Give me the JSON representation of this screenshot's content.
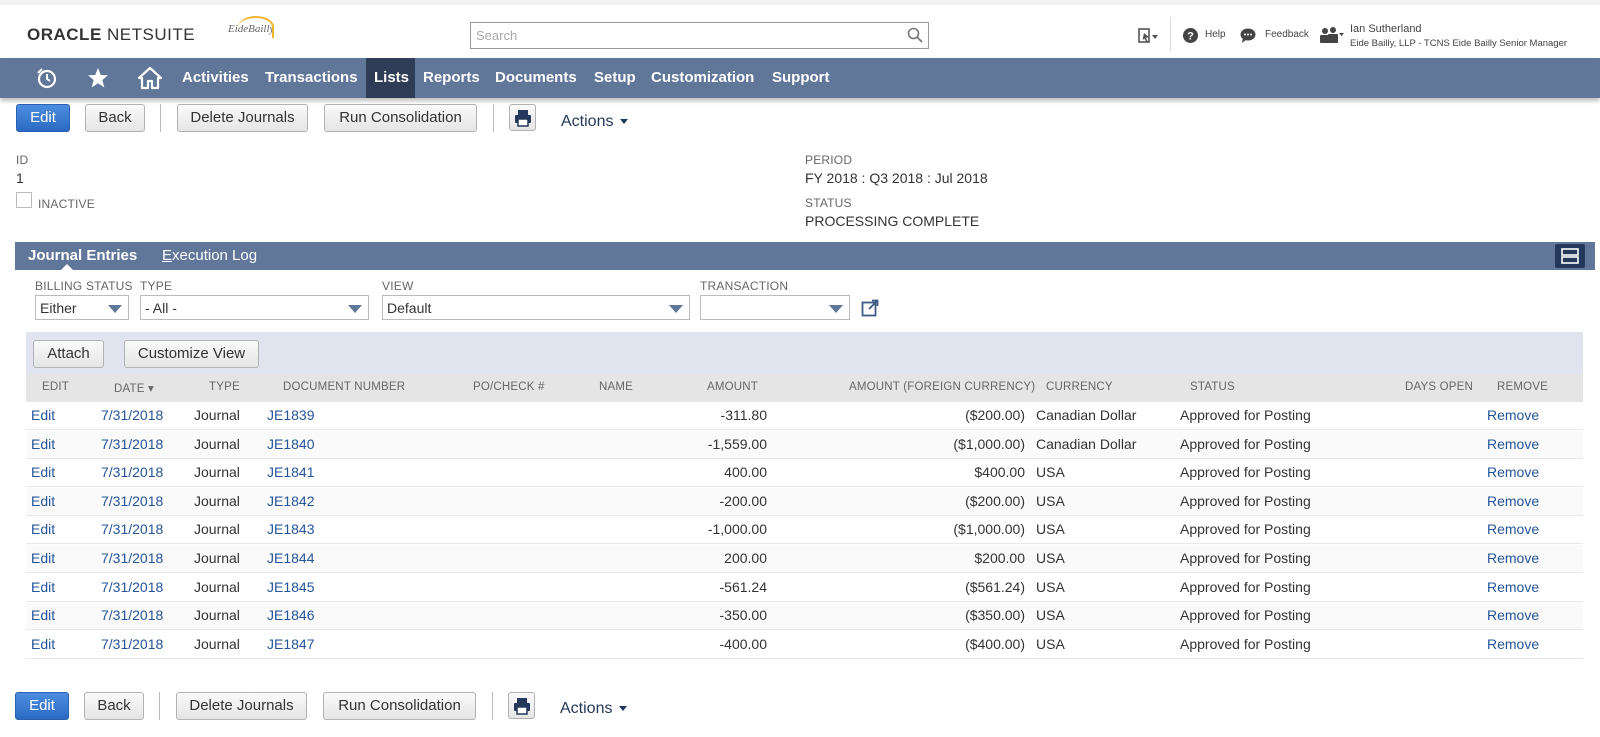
{
  "header": {
    "logo_oracle": "ORACLE",
    "logo_netsuite": "NETSUITE",
    "brand": "EideBailly",
    "search_placeholder": "Search",
    "help": "Help",
    "feedback": "Feedback",
    "user_name": "Ian Sutherland",
    "user_role": "Eide Bailly, LLP - TCNS Eide Bailly Senior Manager"
  },
  "nav": {
    "items": [
      "Activities",
      "Transactions",
      "Lists",
      "Reports",
      "Documents",
      "Setup",
      "Customization",
      "Support"
    ],
    "active": "Lists"
  },
  "toolbar": {
    "edit": "Edit",
    "back": "Back",
    "delete_journals": "Delete Journals",
    "run_consolidation": "Run Consolidation",
    "actions": "Actions"
  },
  "record": {
    "id_label": "ID",
    "id_value": "1",
    "inactive_label": "INACTIVE",
    "period_label": "PERIOD",
    "period_value": "FY 2018 : Q3 2018 : Jul 2018",
    "status_label": "STATUS",
    "status_value": "PROCESSING COMPLETE"
  },
  "subtabs": {
    "journal_entries": "Journal Entries",
    "execution_log_first": "E",
    "execution_log_rest": "xecution Log"
  },
  "filters": {
    "billing_status_label": "BILLING STATUS",
    "billing_status_value": "Either",
    "type_label": "TYPE",
    "type_value": "- All -",
    "view_label": "VIEW",
    "view_value": "Default",
    "transaction_label": "TRANSACTION",
    "transaction_value": ""
  },
  "list_buttons": {
    "attach": "Attach",
    "customize_view": "Customize View"
  },
  "table": {
    "columns": [
      "EDIT",
      "DATE ▾",
      "TYPE",
      "DOCUMENT NUMBER",
      "PO/CHECK #",
      "NAME",
      "AMOUNT",
      "AMOUNT (FOREIGN CURRENCY)",
      "CURRENCY",
      "STATUS",
      "DAYS OPEN",
      "REMOVE"
    ],
    "rows": [
      {
        "edit": "Edit",
        "date": "7/31/2018",
        "type": "Journal",
        "doc": "JE1839",
        "amount": "-311.80",
        "foreign": "($200.00)",
        "currency": "Canadian Dollar",
        "status": "Approved for Posting",
        "remove": "Remove"
      },
      {
        "edit": "Edit",
        "date": "7/31/2018",
        "type": "Journal",
        "doc": "JE1840",
        "amount": "-1,559.00",
        "foreign": "($1,000.00)",
        "currency": "Canadian Dollar",
        "status": "Approved for Posting",
        "remove": "Remove"
      },
      {
        "edit": "Edit",
        "date": "7/31/2018",
        "type": "Journal",
        "doc": "JE1841",
        "amount": "400.00",
        "foreign": "$400.00",
        "currency": "USA",
        "status": "Approved for Posting",
        "remove": "Remove"
      },
      {
        "edit": "Edit",
        "date": "7/31/2018",
        "type": "Journal",
        "doc": "JE1842",
        "amount": "-200.00",
        "foreign": "($200.00)",
        "currency": "USA",
        "status": "Approved for Posting",
        "remove": "Remove"
      },
      {
        "edit": "Edit",
        "date": "7/31/2018",
        "type": "Journal",
        "doc": "JE1843",
        "amount": "-1,000.00",
        "foreign": "($1,000.00)",
        "currency": "USA",
        "status": "Approved for Posting",
        "remove": "Remove"
      },
      {
        "edit": "Edit",
        "date": "7/31/2018",
        "type": "Journal",
        "doc": "JE1844",
        "amount": "200.00",
        "foreign": "$200.00",
        "currency": "USA",
        "status": "Approved for Posting",
        "remove": "Remove"
      },
      {
        "edit": "Edit",
        "date": "7/31/2018",
        "type": "Journal",
        "doc": "JE1845",
        "amount": "-561.24",
        "foreign": "($561.24)",
        "currency": "USA",
        "status": "Approved for Posting",
        "remove": "Remove"
      },
      {
        "edit": "Edit",
        "date": "7/31/2018",
        "type": "Journal",
        "doc": "JE1846",
        "amount": "-350.00",
        "foreign": "($350.00)",
        "currency": "USA",
        "status": "Approved for Posting",
        "remove": "Remove"
      },
      {
        "edit": "Edit",
        "date": "7/31/2018",
        "type": "Journal",
        "doc": "JE1847",
        "amount": "-400.00",
        "foreign": "($400.00)",
        "currency": "USA",
        "status": "Approved for Posting",
        "remove": "Remove"
      }
    ]
  },
  "colors": {
    "nav_bg": "#607799",
    "nav_active": "#2e3c55",
    "primary_button": "#2b6ac2",
    "link": "#255599"
  }
}
